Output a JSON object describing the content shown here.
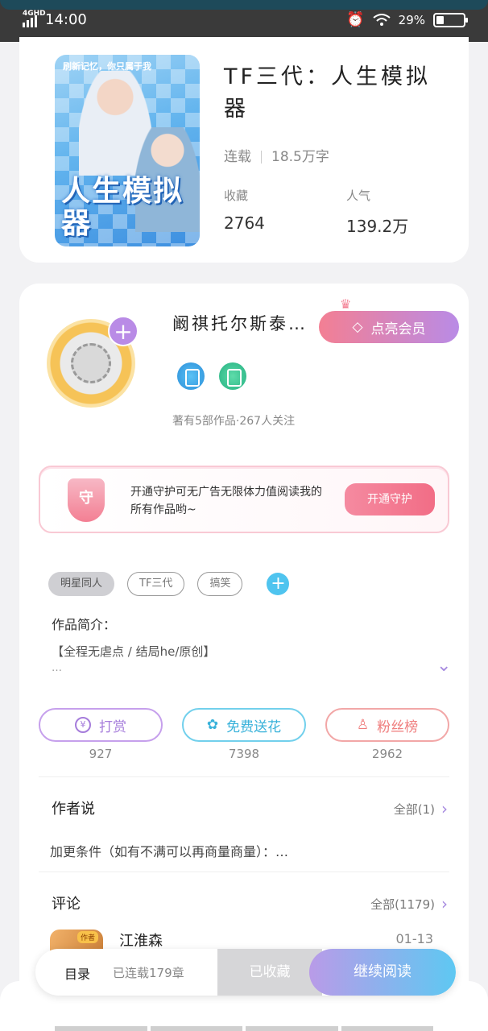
{
  "status_bar": {
    "network": "4GHD",
    "time": "14:00",
    "battery": "29%",
    "battery_fraction": 0.29
  },
  "book": {
    "cover_tag": "刷新记忆，你只属于我",
    "cover_title": "人生模拟器",
    "title": "TF三代：人生模拟器",
    "status": "连载",
    "word_count": "18.5万字",
    "favorites_label": "收藏",
    "favorites_value": "2764",
    "popularity_label": "人气",
    "popularity_value": "139.2万"
  },
  "author": {
    "name": "阚祺托尔斯泰…",
    "vip_button": "点亮会员",
    "stats": "著有5部作品·267人关注"
  },
  "guard": {
    "shield_text": "守",
    "text": "开通守护可无广告无限体力值阅读我的所有作品哟~",
    "button": "开通守护"
  },
  "tags": [
    "明星同人",
    "TF三代",
    "搞笑"
  ],
  "intro": {
    "label": "作品简介：",
    "text": "【全程无虐点 / 结局he/原创】",
    "more": "…"
  },
  "actions": [
    {
      "label": "打赏",
      "icon_text": "¥",
      "count": "927"
    },
    {
      "label": "免费送花",
      "icon_text": "✿",
      "count": "7398"
    },
    {
      "label": "粉丝榜",
      "icon_text": "♙",
      "count": "2962"
    }
  ],
  "author_say": {
    "title": "作者说",
    "link": "全部(1)",
    "text": "加更条件（如有不满可以再商量商量）：…"
  },
  "comments": {
    "title": "评论",
    "link": "全部(1179)",
    "first": {
      "badge": "作者",
      "name": "江淮森",
      "date": "01-13"
    }
  },
  "bottom_bar": {
    "toc": "目录",
    "progress": "已连载179章",
    "collected": "已收藏",
    "continue": "继续阅读"
  }
}
